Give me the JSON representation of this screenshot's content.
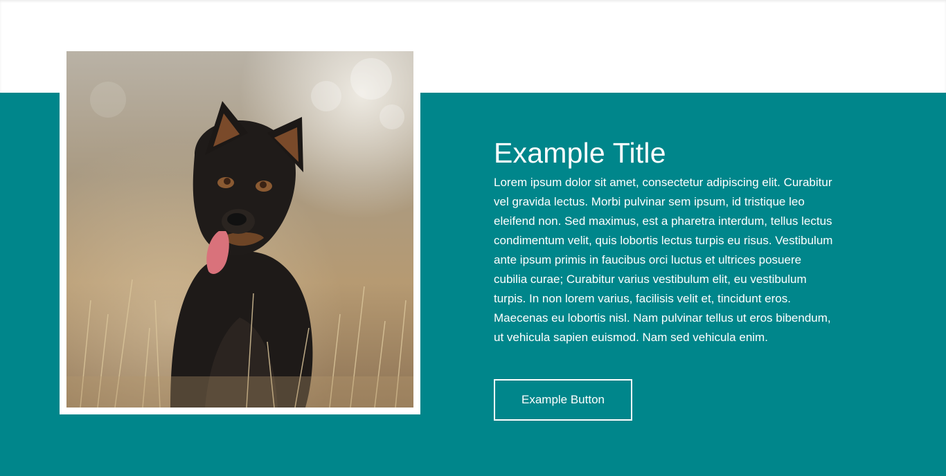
{
  "colors": {
    "accent": "#00868b",
    "background": "#ffffff",
    "text_on_accent": "#ffffff"
  },
  "hero": {
    "image_alt": "dog-photo",
    "title": "Example Title",
    "body": "Lorem ipsum dolor sit amet, consectetur adipiscing elit. Curabitur vel gravida lectus. Morbi pulvinar sem ipsum, id tristique leo eleifend non. Sed maximus, est a pharetra interdum, tellus lectus condimentum velit, quis lobortis lectus turpis eu risus. Vestibulum ante ipsum primis in faucibus orci luctus et ultrices posuere cubilia curae; Curabitur varius vestibulum elit, eu vestibulum turpis. In non lorem varius, facilisis velit et, tincidunt eros. Maecenas eu lobortis nisl. Nam pulvinar tellus ut eros bibendum, ut vehicula sapien euismod. Nam sed vehicula enim.",
    "button_label": "Example Button"
  }
}
